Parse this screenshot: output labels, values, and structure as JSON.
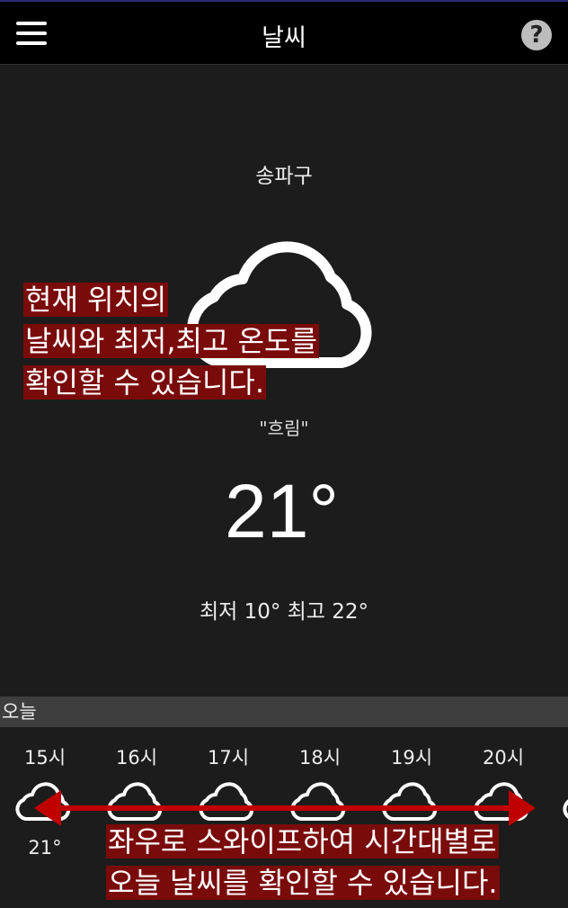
{
  "header": {
    "title": "날씨",
    "help_label": "?"
  },
  "current": {
    "location": "송파구",
    "condition": "\"흐림\"",
    "temperature": "21°",
    "min_max": "최저 10° 최고 22°",
    "icon": "cloud-icon"
  },
  "callout_top": {
    "line1": "현재 위치의",
    "line2": "날씨와 최저,최고 온도를",
    "line3": "확인할 수 있습니다."
  },
  "today": {
    "label": "오늘",
    "hours": [
      {
        "time": "15시",
        "temp": "21°",
        "icon": "cloud-icon"
      },
      {
        "time": "16시",
        "icon": "cloud-icon"
      },
      {
        "time": "17시",
        "icon": "cloud-icon"
      },
      {
        "time": "18시",
        "icon": "cloud-icon"
      },
      {
        "time": "19시",
        "icon": "cloud-icon"
      },
      {
        "time": "20시",
        "icon": "cloud-icon"
      }
    ]
  },
  "callout_bottom": {
    "line1": "좌우로 스와이프하여 시간대별로",
    "line2": "오늘 날씨를 확인할 수 있습니다."
  },
  "colors": {
    "background": "#1c1c1c",
    "topbar": "#000000",
    "callout": "#7a0b0b",
    "arrow": "#c00000",
    "today_bar": "#3e3e3e"
  }
}
